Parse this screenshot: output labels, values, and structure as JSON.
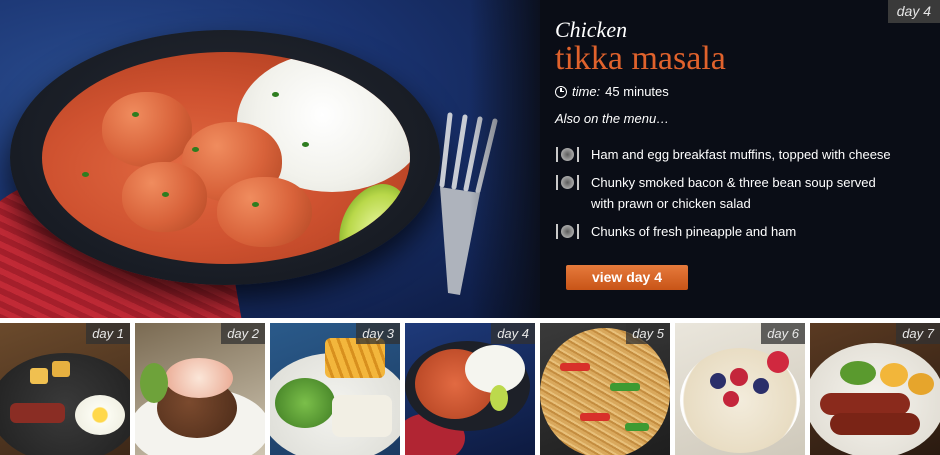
{
  "hero": {
    "day_label": "day 4",
    "title_small": "Chicken",
    "title_big": "tikka masala",
    "time_label": "time:",
    "time_value": "45 minutes",
    "also_label": "Also on the menu…",
    "menu_items": [
      {
        "text": "Ham and egg breakfast muffins, topped with cheese",
        "icon": "plate-cutlery-icon"
      },
      {
        "text": "Chunky smoked bacon & three bean soup served with prawn or chicken salad",
        "icon": "plate-cutlery-icon"
      },
      {
        "text": "Chunks of fresh pineapple and ham",
        "icon": "plate-cutlery-icon"
      }
    ],
    "button_label": "view day 4",
    "accent_color": "#e0622c"
  },
  "thumbnails": [
    {
      "label": "day 1",
      "active": false
    },
    {
      "label": "day 2",
      "active": false
    },
    {
      "label": "day 3",
      "active": false
    },
    {
      "label": "day 4",
      "active": true
    },
    {
      "label": "day 5",
      "active": false
    },
    {
      "label": "day 6",
      "active": false
    },
    {
      "label": "day 7",
      "active": false
    }
  ]
}
